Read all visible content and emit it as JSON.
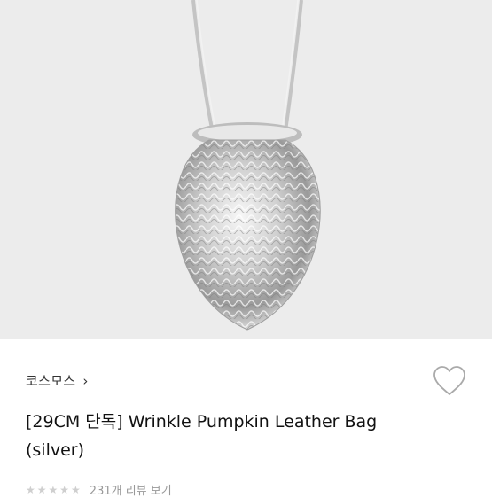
{
  "product": {
    "brand": "코스모스",
    "brand_chevron": "›",
    "title": "[29CM 단독] Wrinkle Pumpkin Leather Bag (silver)",
    "image_alt": "silver wrinkle pumpkin bag",
    "rating": {
      "stars": "★★★★★",
      "review_link": "231개 리뷰 보기"
    }
  },
  "colors": {
    "photo_bg": "#ececec",
    "text": "#111111"
  },
  "icons": {
    "wishlist": "heart-outline-icon"
  }
}
